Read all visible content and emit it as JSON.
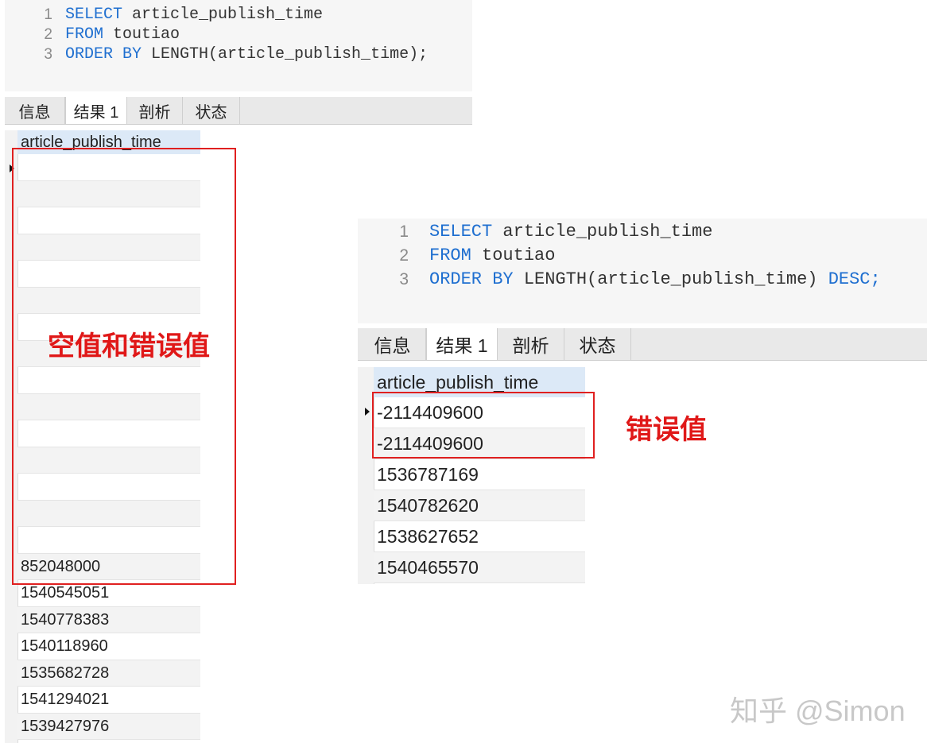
{
  "left_panel": {
    "code": {
      "line_numbers": [
        "1",
        "2",
        "3"
      ],
      "lines": [
        {
          "kw": "SELECT",
          "rest": " article_publish_time"
        },
        {
          "kw": "FROM",
          "rest": " toutiao"
        },
        {
          "kw": "ORDER BY",
          "rest": " LENGTH(article_publish_time);"
        }
      ]
    },
    "tabs": [
      "信息",
      "结果 1",
      "剖析",
      "状态"
    ],
    "active_tab": "结果 1",
    "column_header": "article_publish_time",
    "rows": [
      "",
      "",
      "",
      "",
      "",
      "",
      "",
      "",
      "",
      "",
      "",
      "",
      "",
      "",
      "",
      "852048000",
      "1540545051",
      "1540778383",
      "1540118960",
      "1535682728",
      "1541294021",
      "1539427976"
    ],
    "annotation": "空值和错误值"
  },
  "right_panel": {
    "code": {
      "line_numbers": [
        "1",
        "2",
        "3"
      ],
      "lines": [
        {
          "kw": "SELECT",
          "rest": " article_publish_time",
          "tail": ""
        },
        {
          "kw": "FROM",
          "rest": " toutiao",
          "tail": ""
        },
        {
          "kw": "ORDER BY",
          "rest": " LENGTH(article_publish_time)",
          "tail": " DESC;"
        }
      ]
    },
    "tabs": [
      "信息",
      "结果 1",
      "剖析",
      "状态"
    ],
    "active_tab": "结果 1",
    "column_header": "article_publish_time",
    "rows": [
      "-2114409600",
      "-2114409600",
      "1536787169",
      "1540782620",
      "1538627652",
      "1540465570"
    ],
    "annotation": "错误值"
  },
  "watermark": "知乎 @Simon",
  "colors": {
    "keyword": "#1f6fd0",
    "annotation_red": "#e02020",
    "header_blue": "#dce9f7"
  }
}
